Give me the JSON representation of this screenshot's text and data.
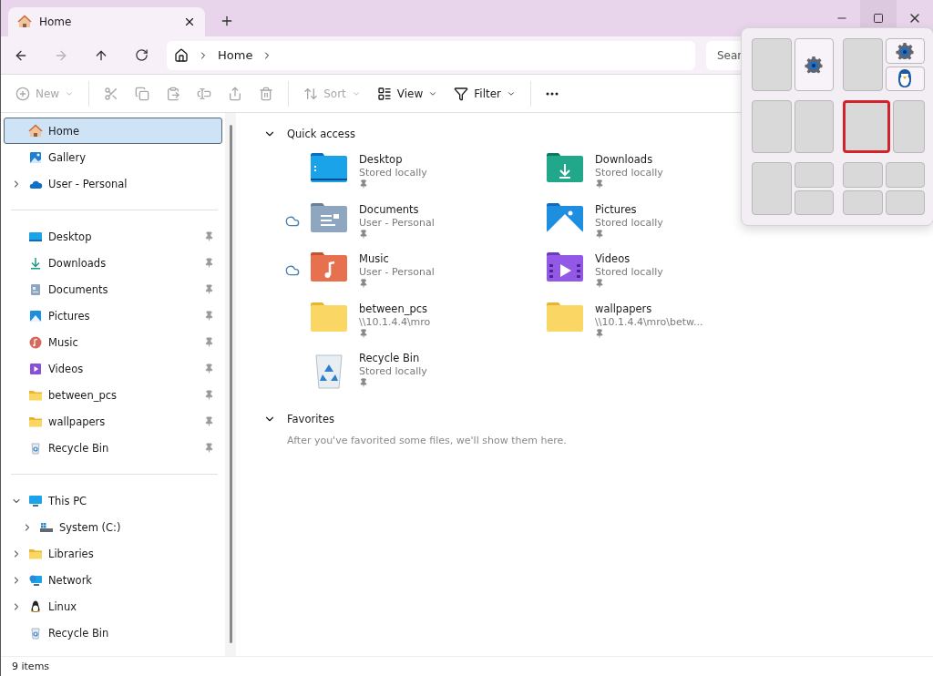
{
  "tab": {
    "title": "Home"
  },
  "nav_buttons": [
    {
      "kind": "back",
      "disabled": false
    },
    {
      "kind": "forward",
      "disabled": true
    },
    {
      "kind": "up",
      "disabled": false
    },
    {
      "kind": "refresh",
      "disabled": false
    }
  ],
  "breadcrumb": [
    "Home"
  ],
  "search": {
    "placeholder": "Sear"
  },
  "toolbar": [
    [
      {
        "kind": "new",
        "label": "New",
        "disabled": true,
        "dropdown": true
      }
    ],
    [
      {
        "kind": "cut",
        "disabled": true
      },
      {
        "kind": "copy",
        "disabled": true
      },
      {
        "kind": "paste",
        "disabled": true
      },
      {
        "kind": "rename",
        "disabled": true
      },
      {
        "kind": "share",
        "disabled": true
      },
      {
        "kind": "delete",
        "disabled": true
      }
    ],
    [
      {
        "kind": "sort",
        "label": "Sort",
        "disabled": true,
        "dropdown": true
      },
      {
        "kind": "view",
        "label": "View",
        "disabled": false,
        "dropdown": true
      },
      {
        "kind": "filter",
        "label": "Filter",
        "disabled": false,
        "dropdown": true
      }
    ],
    [
      {
        "kind": "more",
        "disabled": false
      }
    ]
  ],
  "sidebar": [
    {
      "items": [
        {
          "kind": "home",
          "label": "Home",
          "selected": true,
          "pinned": false
        },
        {
          "kind": "gallery",
          "label": "Gallery",
          "selected": false,
          "pinned": false
        },
        {
          "kind": "cloud",
          "label": "User - Personal",
          "selected": false,
          "expanded": false,
          "pinned": false
        }
      ]
    },
    {
      "items": [
        {
          "kind": "desktop",
          "label": "Desktop",
          "selected": false,
          "pinned": true
        },
        {
          "kind": "downloads",
          "label": "Downloads",
          "selected": false,
          "pinned": true
        },
        {
          "kind": "documents",
          "label": "Documents",
          "selected": false,
          "pinned": true
        },
        {
          "kind": "pictures",
          "label": "Pictures",
          "selected": false,
          "pinned": true
        },
        {
          "kind": "music",
          "label": "Music",
          "selected": false,
          "pinned": true
        },
        {
          "kind": "videos",
          "label": "Videos",
          "selected": false,
          "pinned": true
        },
        {
          "kind": "folder",
          "label": "between_pcs",
          "selected": false,
          "pinned": true
        },
        {
          "kind": "folder",
          "label": "wallpapers",
          "selected": false,
          "pinned": true
        },
        {
          "kind": "recycle",
          "label": "Recycle Bin",
          "selected": false,
          "pinned": true
        }
      ]
    },
    {
      "items": [
        {
          "kind": "pc",
          "label": "This PC",
          "selected": false,
          "expanded": true,
          "pinned": false,
          "children": [
            {
              "kind": "drive",
              "label": "System (C:)",
              "selected": false,
              "expanded": false,
              "pinned": false
            }
          ]
        },
        {
          "kind": "folder",
          "label": "Libraries",
          "selected": false,
          "expanded": false,
          "pinned": false
        },
        {
          "kind": "network",
          "label": "Network",
          "selected": false,
          "expanded": false,
          "pinned": false
        },
        {
          "kind": "linux",
          "label": "Linux",
          "selected": false,
          "expanded": false,
          "pinned": false
        },
        {
          "kind": "recycle",
          "label": "Recycle Bin",
          "selected": false,
          "pinned": false
        }
      ]
    }
  ],
  "quick_access": {
    "title": "Quick access",
    "expanded": true,
    "items": [
      {
        "kind": "desktop",
        "name": "Desktop",
        "detail": "Stored locally",
        "cloud": false,
        "pinned": true
      },
      {
        "kind": "downloads",
        "name": "Downloads",
        "detail": "Stored locally",
        "cloud": false,
        "pinned": true
      },
      {
        "kind": "documents",
        "name": "Documents",
        "detail": "User - Personal",
        "cloud": true,
        "pinned": true
      },
      {
        "kind": "pictures",
        "name": "Pictures",
        "detail": "Stored locally",
        "cloud": false,
        "pinned": true
      },
      {
        "kind": "music",
        "name": "Music",
        "detail": "User - Personal",
        "cloud": true,
        "pinned": true
      },
      {
        "kind": "videos",
        "name": "Videos",
        "detail": "Stored locally",
        "cloud": false,
        "pinned": true
      },
      {
        "kind": "folder",
        "name": "between_pcs",
        "detail": "\\\\10.1.4.4\\mro",
        "cloud": false,
        "pinned": true
      },
      {
        "kind": "folder",
        "name": "wallpapers",
        "detail": "\\\\10.1.4.4\\mro\\betw...",
        "cloud": false,
        "pinned": true
      },
      {
        "kind": "recycle",
        "name": "Recycle Bin",
        "detail": "Stored locally",
        "cloud": false,
        "pinned": true
      }
    ]
  },
  "favorites": {
    "title": "Favorites",
    "expanded": true,
    "empty_text": "After you've favorited some files, we'll show them here."
  },
  "status_bar": {
    "item_count": "9 items"
  },
  "snap_layouts": [
    {
      "kind": "halves",
      "zones": [
        {
          "kind": "empty",
          "selected": false
        },
        {
          "kind": "gear",
          "selected": false
        }
      ]
    },
    {
      "kind": "half-stack",
      "zones": [
        {
          "kind": "empty",
          "selected": false
        },
        {
          "kind": "gear",
          "selected": false
        },
        {
          "kind": "penguin",
          "selected": false
        }
      ]
    },
    {
      "kind": "halves",
      "zones": [
        {
          "kind": "empty",
          "selected": false
        },
        {
          "kind": "empty",
          "selected": false
        }
      ]
    },
    {
      "kind": "wide-narrow",
      "zones": [
        {
          "kind": "empty",
          "selected": true
        },
        {
          "kind": "empty",
          "selected": false
        }
      ]
    },
    {
      "kind": "half-stack",
      "zones": [
        {
          "kind": "empty",
          "selected": false
        },
        {
          "kind": "empty",
          "selected": false
        },
        {
          "kind": "empty",
          "selected": false
        }
      ]
    },
    {
      "kind": "quad",
      "zones": [
        {
          "kind": "empty",
          "selected": false
        },
        {
          "kind": "empty",
          "selected": false
        },
        {
          "kind": "empty",
          "selected": false
        },
        {
          "kind": "empty",
          "selected": false
        }
      ]
    }
  ]
}
